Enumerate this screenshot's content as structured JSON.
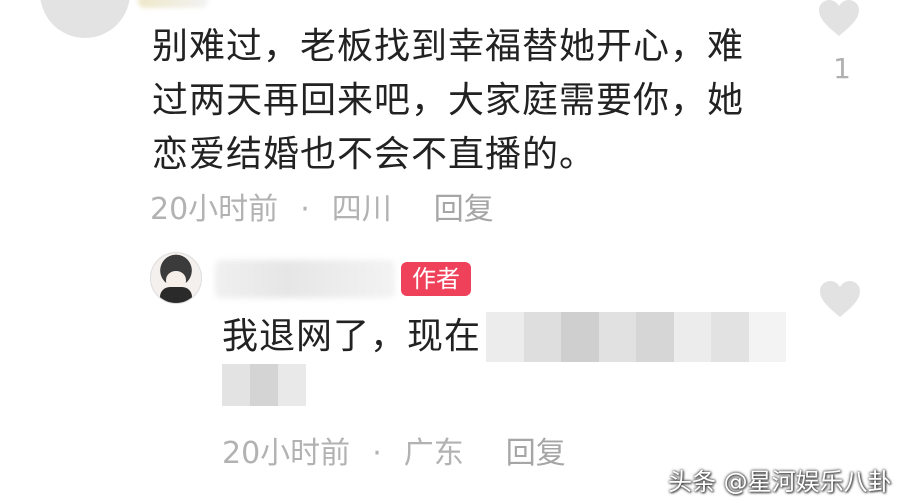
{
  "comment": {
    "text": "别难过，老板找到幸福替她开心，难\n过两天再回来吧，大家庭需要你，她\n恋爱结婚也不会不直播的。",
    "time": "20小时前",
    "separator": "·",
    "location": "四川",
    "reply_label": "回复",
    "like_count": "1",
    "like_icon": "heart-outline-icon"
  },
  "reply": {
    "author_badge": "作者",
    "text_visible": "我退网了，现在",
    "time": "20小时前",
    "separator": "·",
    "location": "广东",
    "reply_label": "回复",
    "like_icon": "heart-outline-icon"
  },
  "watermark": "头条 @星河娱乐八卦",
  "colors": {
    "badge": "#f0415a",
    "meta_text": "#b2b2b2",
    "heart": "#e2e2e2"
  }
}
